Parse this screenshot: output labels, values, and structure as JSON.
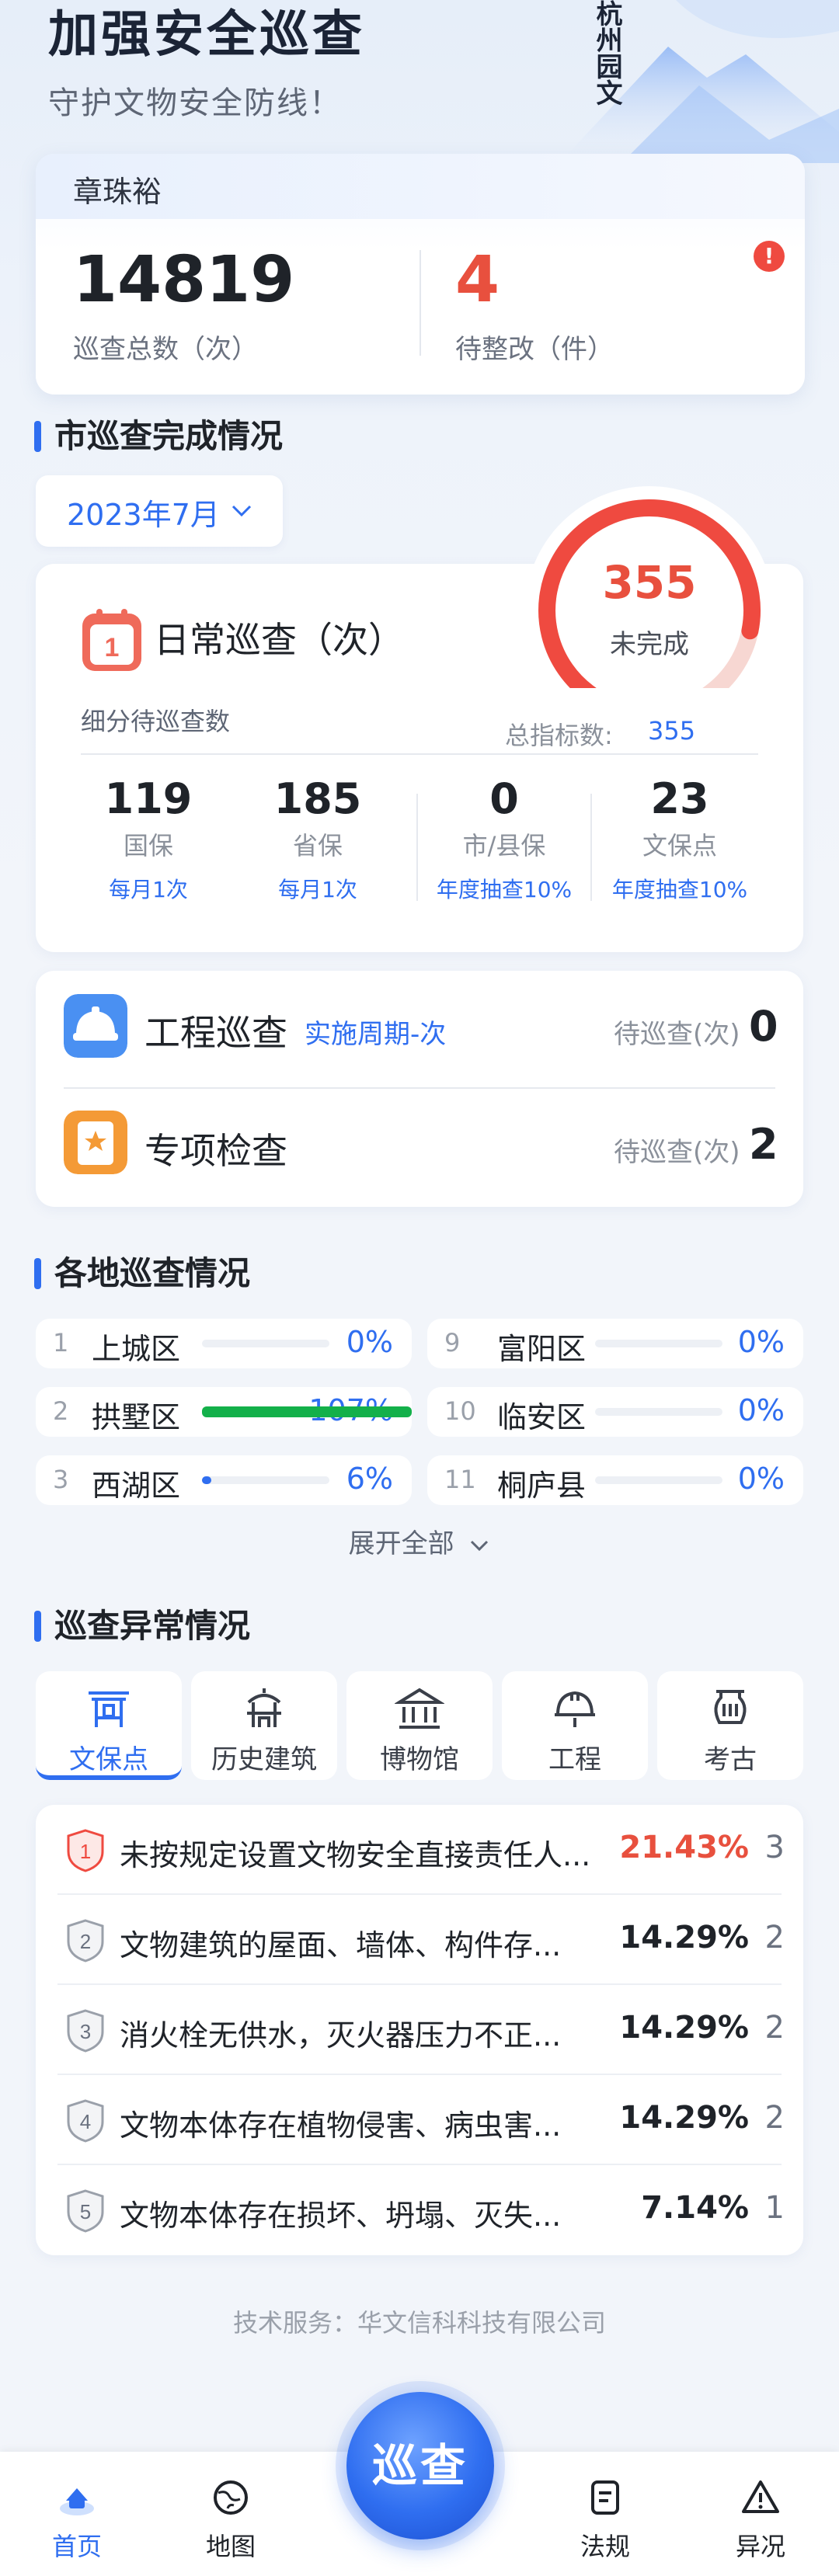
{
  "header": {
    "title": "加强安全巡查",
    "subtitle": "守护文物安全防线！",
    "logo_text": "杭州园文"
  },
  "user_card": {
    "name": "章珠裕",
    "total_value": "14819",
    "total_label": "巡查总数（次）",
    "pending_value": "4",
    "pending_label": "待整改（件）",
    "alert_mark": "!"
  },
  "city_section": {
    "title": "市巡查完成情况",
    "month": "2023年7月"
  },
  "daily": {
    "title": "日常巡查（次）",
    "calendar_mark": "1",
    "gauge_value": "355",
    "gauge_label": "未完成",
    "gauge_fraction": 0.85,
    "breakdown_label": "细分待巡查数",
    "target_label": "总指标数:",
    "target_value": "355",
    "stats": [
      {
        "value": "119",
        "name": "国保",
        "freq": "每月1次"
      },
      {
        "value": "185",
        "name": "省保",
        "freq": "每月1次"
      },
      {
        "value": "0",
        "name": "市/县保",
        "freq": "年度抽查10%"
      },
      {
        "value": "23",
        "name": "文保点",
        "freq": "年度抽查10%"
      }
    ]
  },
  "engineering": {
    "title": "工程巡查",
    "period": "实施周期-次",
    "wait_label": "待巡查(次)",
    "count": "0"
  },
  "special": {
    "title": "专项检查",
    "wait_label": "待巡查(次)",
    "count": "2"
  },
  "region_section": {
    "title": "各地巡查情况",
    "expand_label": "展开全部",
    "left": [
      {
        "idx": "1",
        "name": "上城区",
        "pct": "0%",
        "fraction": 0.0
      },
      {
        "idx": "2",
        "name": "拱墅区",
        "pct": "107%",
        "fraction": 1.07
      },
      {
        "idx": "3",
        "name": "西湖区",
        "pct": "6%",
        "fraction": 0.06
      }
    ],
    "right": [
      {
        "idx": "9",
        "name": "富阳区",
        "pct": "0%",
        "fraction": 0.0
      },
      {
        "idx": "10",
        "name": "临安区",
        "pct": "0%",
        "fraction": 0.0
      },
      {
        "idx": "11",
        "name": "桐庐县",
        "pct": "0%",
        "fraction": 0.0
      }
    ]
  },
  "anomaly_section": {
    "title": "巡查异常情况",
    "categories": [
      {
        "label": "文保点",
        "icon": "gate-icon"
      },
      {
        "label": "历史建筑",
        "icon": "pavilion-icon"
      },
      {
        "label": "博物馆",
        "icon": "museum-icon"
      },
      {
        "label": "工程",
        "icon": "helmet-icon"
      },
      {
        "label": "考古",
        "icon": "pottery-icon"
      }
    ],
    "items": [
      {
        "rank": "1",
        "text": "未按规定设置文物安全直接责任人...",
        "pct": "21.43%",
        "count": "3"
      },
      {
        "rank": "2",
        "text": "文物建筑的屋面、墙体、构件存...",
        "pct": "14.29%",
        "count": "2"
      },
      {
        "rank": "3",
        "text": "消火栓无供水，灭火器压力不正...",
        "pct": "14.29%",
        "count": "2"
      },
      {
        "rank": "4",
        "text": "文物本体存在植物侵害、病虫害...",
        "pct": "14.29%",
        "count": "2"
      },
      {
        "rank": "5",
        "text": "文物本体存在损坏、坍塌、灭失...",
        "pct": "7.14%",
        "count": "1"
      }
    ]
  },
  "footer": {
    "credit": "技术服务：华文信科科技有限公司"
  },
  "tabbar": {
    "items": [
      {
        "label": "首页",
        "icon": "home-icon"
      },
      {
        "label": "地图",
        "icon": "map-icon"
      },
      {
        "label": "法规",
        "icon": "document-icon"
      },
      {
        "label": "异况",
        "icon": "warning-icon"
      }
    ],
    "center_label": "巡查"
  },
  "colors": {
    "accent": "#2f6ef0",
    "danger": "#ef4a40",
    "success": "#13b04a"
  }
}
